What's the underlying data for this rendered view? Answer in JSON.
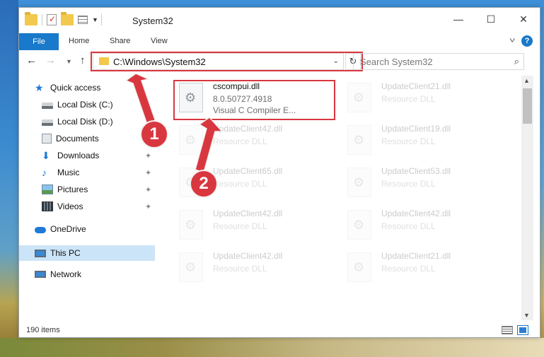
{
  "window": {
    "title": "System32",
    "controls": {
      "minimize": "—",
      "maximize": "☐",
      "close": "✕"
    }
  },
  "ribbon": {
    "file_tab": "File",
    "tabs": [
      "Home",
      "Share",
      "View"
    ],
    "help": "?"
  },
  "nav": {
    "address": "C:\\Windows\\System32",
    "search_placeholder": "Search System32"
  },
  "sidebar": {
    "items": [
      {
        "label": "Quick access",
        "icon": "star-icon"
      },
      {
        "label": "Local Disk (C:)",
        "icon": "drive-icon",
        "pinned": true
      },
      {
        "label": "Local Disk (D:)",
        "icon": "drive-icon"
      },
      {
        "label": "Documents",
        "icon": "documents-icon"
      },
      {
        "label": "Downloads",
        "icon": "downloads-icon",
        "pinned": true
      },
      {
        "label": "Music",
        "icon": "music-icon",
        "pinned": true
      },
      {
        "label": "Pictures",
        "icon": "pictures-icon",
        "pinned": true
      },
      {
        "label": "Videos",
        "icon": "videos-icon",
        "pinned": true
      },
      {
        "label": "OneDrive",
        "icon": "onedrive-icon"
      },
      {
        "label": "This PC",
        "icon": "this-pc-icon",
        "selected": true
      },
      {
        "label": "Network",
        "icon": "network-icon"
      }
    ]
  },
  "files": [
    {
      "name": "cscompui.dll",
      "line2": "8.0.50727.4918",
      "line3": "Visual C Compiler E...",
      "highlighted": true
    },
    {
      "name": "UpdateClient21.dll",
      "line2": "Resource DLL"
    },
    {
      "name": "UpdateClient42.dll",
      "line2": "Resource DLL"
    },
    {
      "name": "UpdateClient19.dll",
      "line2": "Resource DLL"
    },
    {
      "name": "UpdateClient65.dll",
      "line2": "Resource DLL"
    },
    {
      "name": "UpdateClient53.dll",
      "line2": "Resource DLL"
    },
    {
      "name": "UpdateClient42.dll",
      "line2": "Resource DLL"
    },
    {
      "name": "UpdateClient42.dll",
      "line2": "Resource DLL"
    },
    {
      "name": "UpdateClient42.dll",
      "line2": "Resource DLL"
    },
    {
      "name": "UpdateClient21.dll",
      "line2": "Resource DLL"
    }
  ],
  "status": {
    "item_count": "190 items"
  },
  "annotations": {
    "badge1": "1",
    "badge2": "2",
    "color": "#d9373f"
  }
}
